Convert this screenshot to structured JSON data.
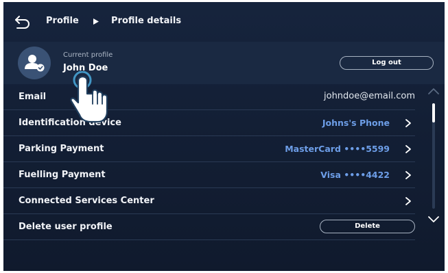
{
  "header": {
    "back_icon": "back-arrow-icon",
    "breadcrumb": [
      "Profile",
      "Profile details"
    ],
    "separator_icon": "triangle-right-icon"
  },
  "profile": {
    "label": "Current profile",
    "name": "John Doe",
    "avatar_icon": "user-check-icon",
    "logout_label": "Log out"
  },
  "rows": [
    {
      "label": "Email",
      "value": "johndoe@email.com",
      "chevron": false
    },
    {
      "label": "Identification device",
      "value": "Johns's Phone",
      "chevron": true
    },
    {
      "label": "Parking Payment",
      "value": "MasterCard ••••5599",
      "chevron": true
    },
    {
      "label": "Fuelling Payment",
      "value": "Visa ••••4422",
      "chevron": true
    },
    {
      "label": "Connected Services Center",
      "value": "",
      "chevron": true
    },
    {
      "label": "Delete user profile",
      "button": "Delete"
    }
  ],
  "scrollbar": {
    "position": 0.0
  },
  "colors": {
    "background": "#131f35",
    "accent_value": "#6d9ee8",
    "text": "#ffffff"
  },
  "overlay_icon": "tap-hand-icon"
}
